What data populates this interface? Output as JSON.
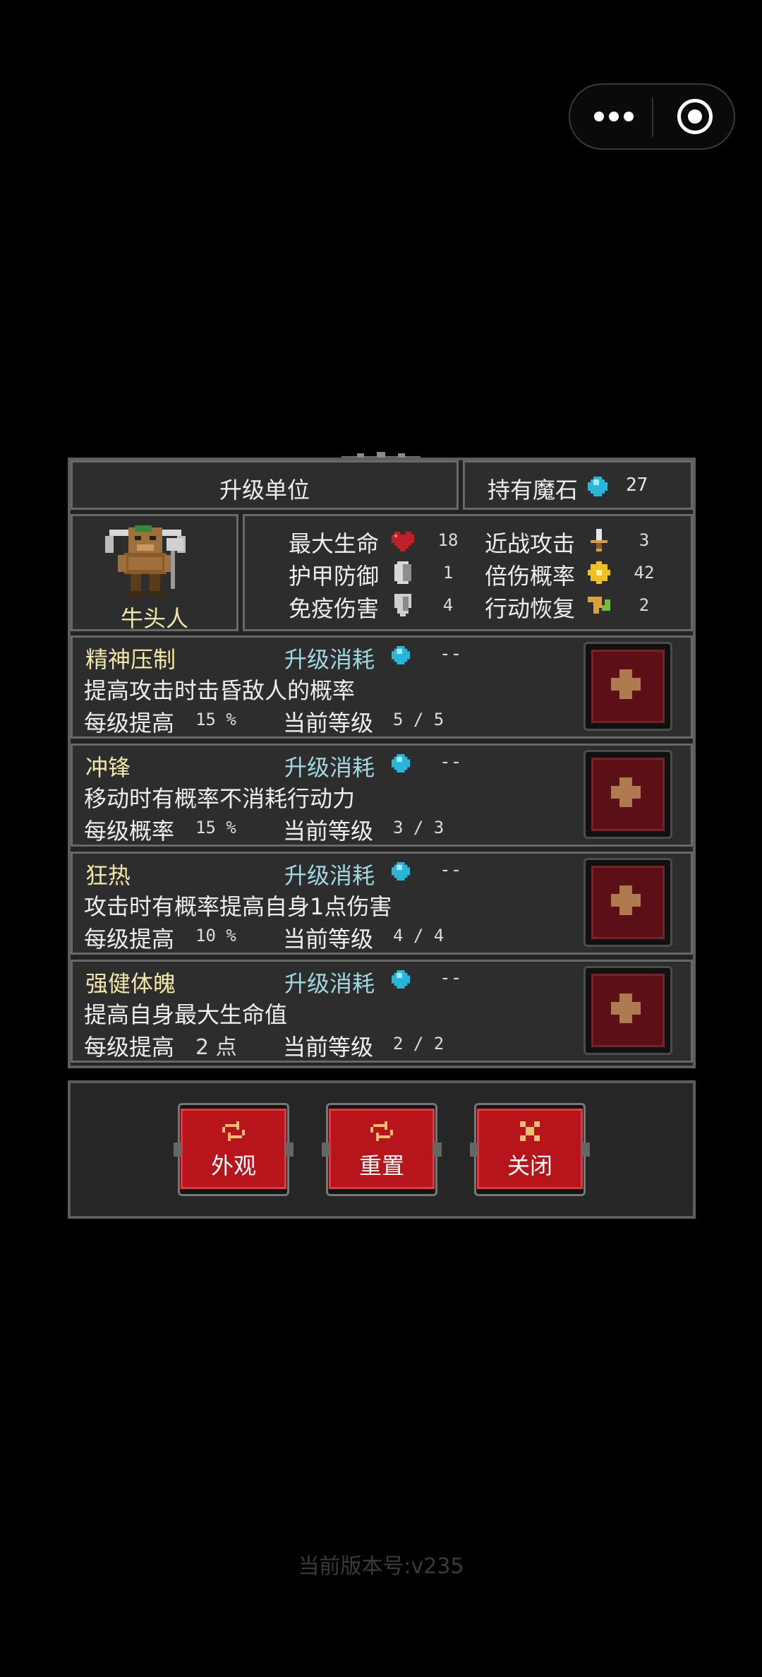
{
  "header": {
    "title": "升级单位",
    "stone_label": "持有魔石",
    "stone_count": "27"
  },
  "unit": {
    "name": "牛头人",
    "stats": [
      {
        "label": "最大生命",
        "icon": "heart-icon",
        "value": "18"
      },
      {
        "label": "护甲防御",
        "icon": "armor-icon",
        "value": "1"
      },
      {
        "label": "免疫伤害",
        "icon": "shield-icon",
        "value": "4"
      },
      {
        "label": "近战攻击",
        "icon": "sword-icon",
        "value": "3"
      },
      {
        "label": "倍伤概率",
        "icon": "burst-icon",
        "value": "42"
      },
      {
        "label": "行动恢复",
        "icon": "boot-icon",
        "value": "2"
      }
    ]
  },
  "skills": [
    {
      "name": "精神压制",
      "cost_label": "升级消耗",
      "cost": "--",
      "desc": "提高攻击时击昏敌人的概率",
      "per_label": "每级提高",
      "per_value": "15 %",
      "level_label": "当前等级",
      "level": "5 / 5"
    },
    {
      "name": "冲锋",
      "cost_label": "升级消耗",
      "cost": "--",
      "desc": "移动时有概率不消耗行动力",
      "per_label": "每级概率",
      "per_value": "15 %",
      "level_label": "当前等级",
      "level": "3 / 3"
    },
    {
      "name": "狂热",
      "cost_label": "升级消耗",
      "cost": "--",
      "desc": "攻击时有概率提高自身1点伤害",
      "per_label": "每级提高",
      "per_value": "10 %",
      "level_label": "当前等级",
      "level": "4 / 4"
    },
    {
      "name": "强健体魄",
      "cost_label": "升级消耗",
      "cost": "--",
      "desc": "提高自身最大生命值",
      "per_label": "每级提高",
      "per_value": "2 点",
      "level_label": "当前等级",
      "level": "2 / 2"
    }
  ],
  "buttons": {
    "appearance": "外观",
    "reset": "重置",
    "close": "关闭"
  },
  "version": "当前版本号:v235",
  "colors": {
    "gem": "#29b6d8",
    "button_face": "#b8141c",
    "plus_face": "#5a1016",
    "skill_name": "#f0e6a8",
    "cost_label": "#9fd8e0"
  }
}
